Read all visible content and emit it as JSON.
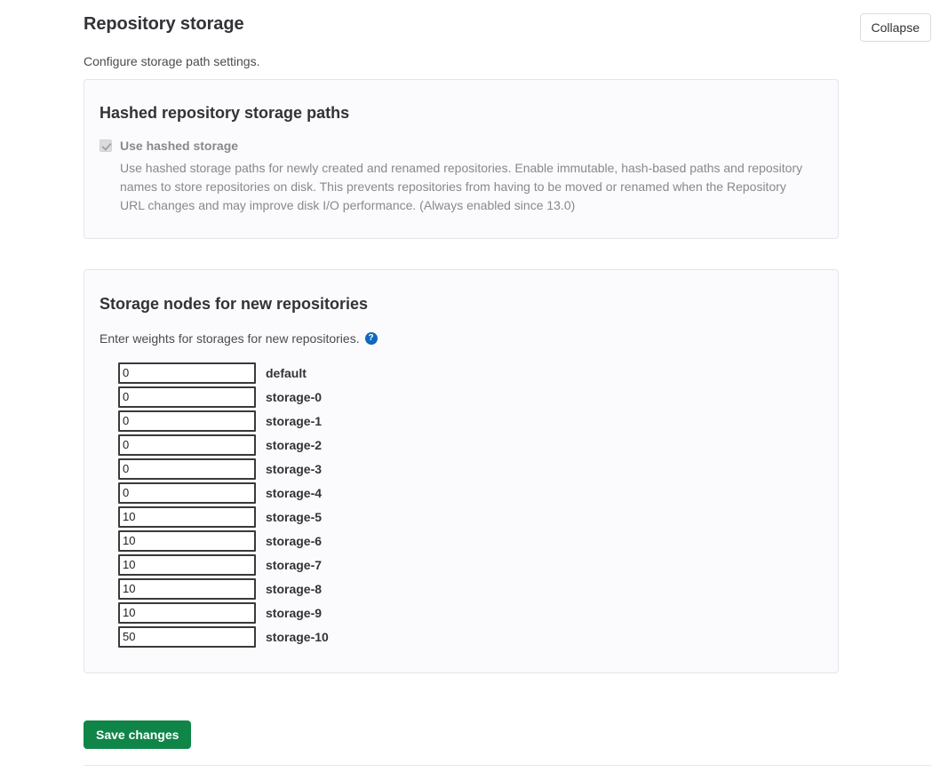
{
  "header": {
    "title": "Repository storage",
    "subtitle": "Configure storage path settings.",
    "collapse_label": "Collapse"
  },
  "hashed_section": {
    "title": "Hashed repository storage paths",
    "checkbox_label": "Use hashed storage",
    "checkbox_checked": true,
    "checkbox_disabled": true,
    "description": "Use hashed storage paths for newly created and renamed repositories. Enable immutable, hash-based paths and repository names to store repositories on disk. This prevents repositories from having to be moved or renamed when the Repository URL changes and may improve disk I/O performance. (Always enabled since 13.0)"
  },
  "nodes_section": {
    "title": "Storage nodes for new repositories",
    "help_text": "Enter weights for storages for new repositories.",
    "help_icon": "question-circle-icon",
    "rows": [
      {
        "value": "0",
        "name": "default"
      },
      {
        "value": "0",
        "name": "storage-0"
      },
      {
        "value": "0",
        "name": "storage-1"
      },
      {
        "value": "0",
        "name": "storage-2"
      },
      {
        "value": "0",
        "name": "storage-3"
      },
      {
        "value": "0",
        "name": "storage-4"
      },
      {
        "value": "10",
        "name": "storage-5"
      },
      {
        "value": "10",
        "name": "storage-6"
      },
      {
        "value": "10",
        "name": "storage-7"
      },
      {
        "value": "10",
        "name": "storage-8"
      },
      {
        "value": "10",
        "name": "storage-9"
      },
      {
        "value": "50",
        "name": "storage-10"
      }
    ]
  },
  "footer": {
    "save_label": "Save changes"
  },
  "colors": {
    "save_green": "#108548",
    "help_blue": "#1068bf",
    "card_bg": "#fbfafd",
    "card_border": "#e6e4e9",
    "muted_text": "#89888d"
  }
}
